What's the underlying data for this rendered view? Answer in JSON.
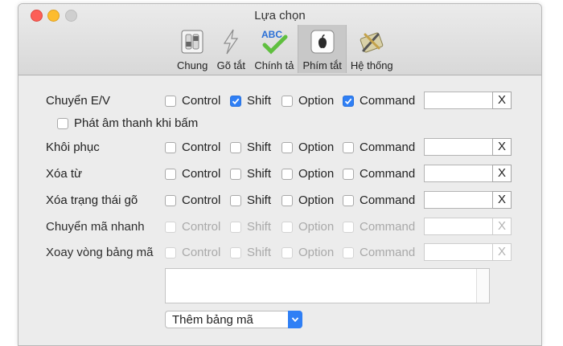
{
  "window": {
    "title": "Lựa chọn"
  },
  "tabs": [
    {
      "label": "Chung",
      "icon": "switch-panel-icon",
      "active": false
    },
    {
      "label": "Gõ tắt",
      "icon": "lightning-icon",
      "active": false
    },
    {
      "label": "Chính tả",
      "icon": "abc-check-icon",
      "active": false
    },
    {
      "label": "Phím tắt",
      "icon": "apple-key-icon",
      "active": true
    },
    {
      "label": "Hệ thống",
      "icon": "tools-icon",
      "active": false
    }
  ],
  "modifier_labels": {
    "control": "Control",
    "shift": "Shift",
    "option": "Option",
    "command": "Command"
  },
  "clear_label": "X",
  "rows": [
    {
      "label": "Chuyển E/V",
      "control": false,
      "shift": true,
      "option": false,
      "command": true,
      "key": "",
      "enabled": true
    },
    {
      "label": "Khôi phục",
      "control": false,
      "shift": false,
      "option": false,
      "command": false,
      "key": "",
      "enabled": true
    },
    {
      "label": "Xóa từ",
      "control": false,
      "shift": false,
      "option": false,
      "command": false,
      "key": "",
      "enabled": true
    },
    {
      "label": "Xóa trạng thái gõ",
      "control": false,
      "shift": false,
      "option": false,
      "command": false,
      "key": "",
      "enabled": true
    },
    {
      "label": "Chuyển mã nhanh",
      "control": false,
      "shift": false,
      "option": false,
      "command": false,
      "key": "",
      "enabled": false
    },
    {
      "label": "Xoay vòng bảng mã",
      "control": false,
      "shift": false,
      "option": false,
      "command": false,
      "key": "",
      "enabled": false
    }
  ],
  "sound_option": {
    "label": "Phát âm thanh khi bấm",
    "checked": false
  },
  "add_table": {
    "label": "Thêm bảng mã"
  },
  "colors": {
    "accent": "#2f7ff5",
    "window_bg": "#ececec",
    "toolbar_bg": "#d8d8d8"
  }
}
